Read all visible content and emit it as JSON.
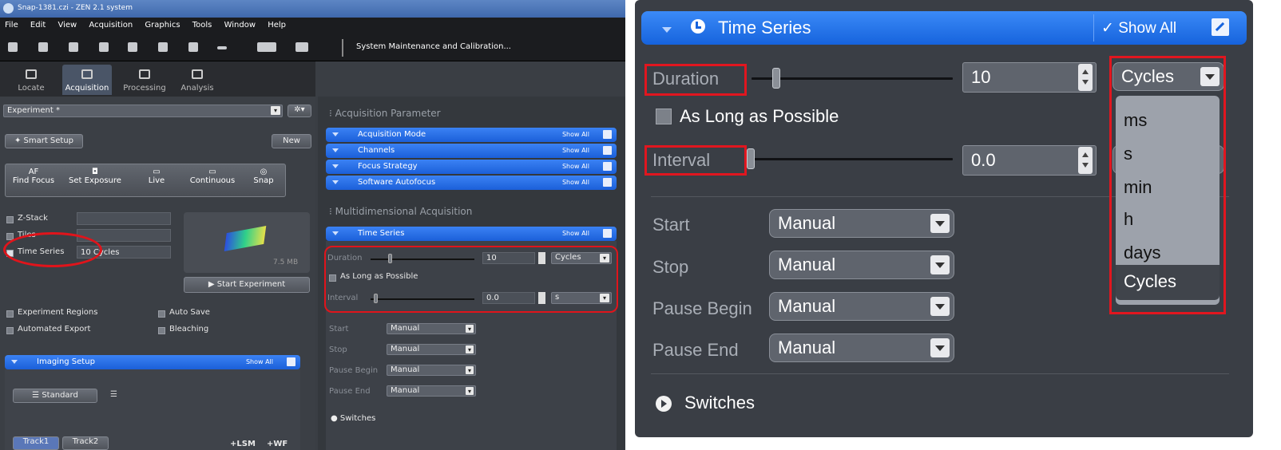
{
  "left": {
    "window_title": "Snap-1381.czi - ZEN 2.1 system",
    "menu": [
      "File",
      "Edit",
      "View",
      "Acquisition",
      "Graphics",
      "Tools",
      "Window",
      "Help"
    ],
    "system_maintenance": "System Maintenance and Calibration...",
    "mode_tabs": [
      "Locate",
      "Acquisition",
      "Processing",
      "Analysis"
    ],
    "experiment": "Experiment *",
    "smart_setup": "Smart Setup",
    "new_label": "New",
    "tools": [
      "Find Focus",
      "Set Exposure",
      "Live",
      "Continuous",
      "Snap"
    ],
    "tool_icons": [
      "AF",
      "",
      "",
      "",
      ""
    ],
    "z_stack": "Z-Stack",
    "tiles": "Tiles",
    "time_series": "Time Series",
    "time_series_value": "10 Cycles",
    "file_size": "7.5 MB",
    "start_experiment": "Start Experiment",
    "experiment_regions": "Experiment Regions",
    "auto_save": "Auto Save",
    "automated_export": "Automated Export",
    "bleaching": "Bleaching",
    "imaging_setup": "Imaging Setup",
    "show_all": "Show All",
    "standard": "Standard",
    "tracks": [
      "Track1",
      "Track2"
    ],
    "lsm": "+LSM",
    "wf": "+WF",
    "acq_param_header": "Acquisition Parameter",
    "acq_bars": [
      "Acquisition Mode",
      "Channels",
      "Focus Strategy",
      "Software Autofocus"
    ],
    "multi_header": "Multidimensional Acquisition",
    "ts_bar": "Time Series",
    "duration_label": "Duration",
    "duration_value": "10",
    "duration_unit": "Cycles",
    "as_long": "As Long as Possible",
    "interval_label": "Interval",
    "interval_value": "0.0",
    "interval_unit": "s",
    "start_label": "Start",
    "stop_label": "Stop",
    "pause_begin_label": "Pause Begin",
    "pause_end_label": "Pause End",
    "manual": "Manual",
    "switches": "Switches"
  },
  "right": {
    "title": "Time Series",
    "show_all": "✓ Show All",
    "duration_label": "Duration",
    "duration_value": "10",
    "duration_unit": "Cycles",
    "as_long": "As Long as Possible",
    "interval_label": "Interval",
    "interval_value": "0.0",
    "start_label": "Start",
    "stop_label": "Stop",
    "pause_begin_label": "Pause Begin",
    "pause_end_label": "Pause End",
    "manual": "Manual",
    "switches": "Switches",
    "unit_options": [
      "ms",
      "s",
      "min",
      "h",
      "days",
      "Cycles"
    ]
  },
  "colors": {
    "accent_blue": "#1b5fd9",
    "highlight_red": "#e0141b",
    "panel_dark": "#3a3e45"
  }
}
